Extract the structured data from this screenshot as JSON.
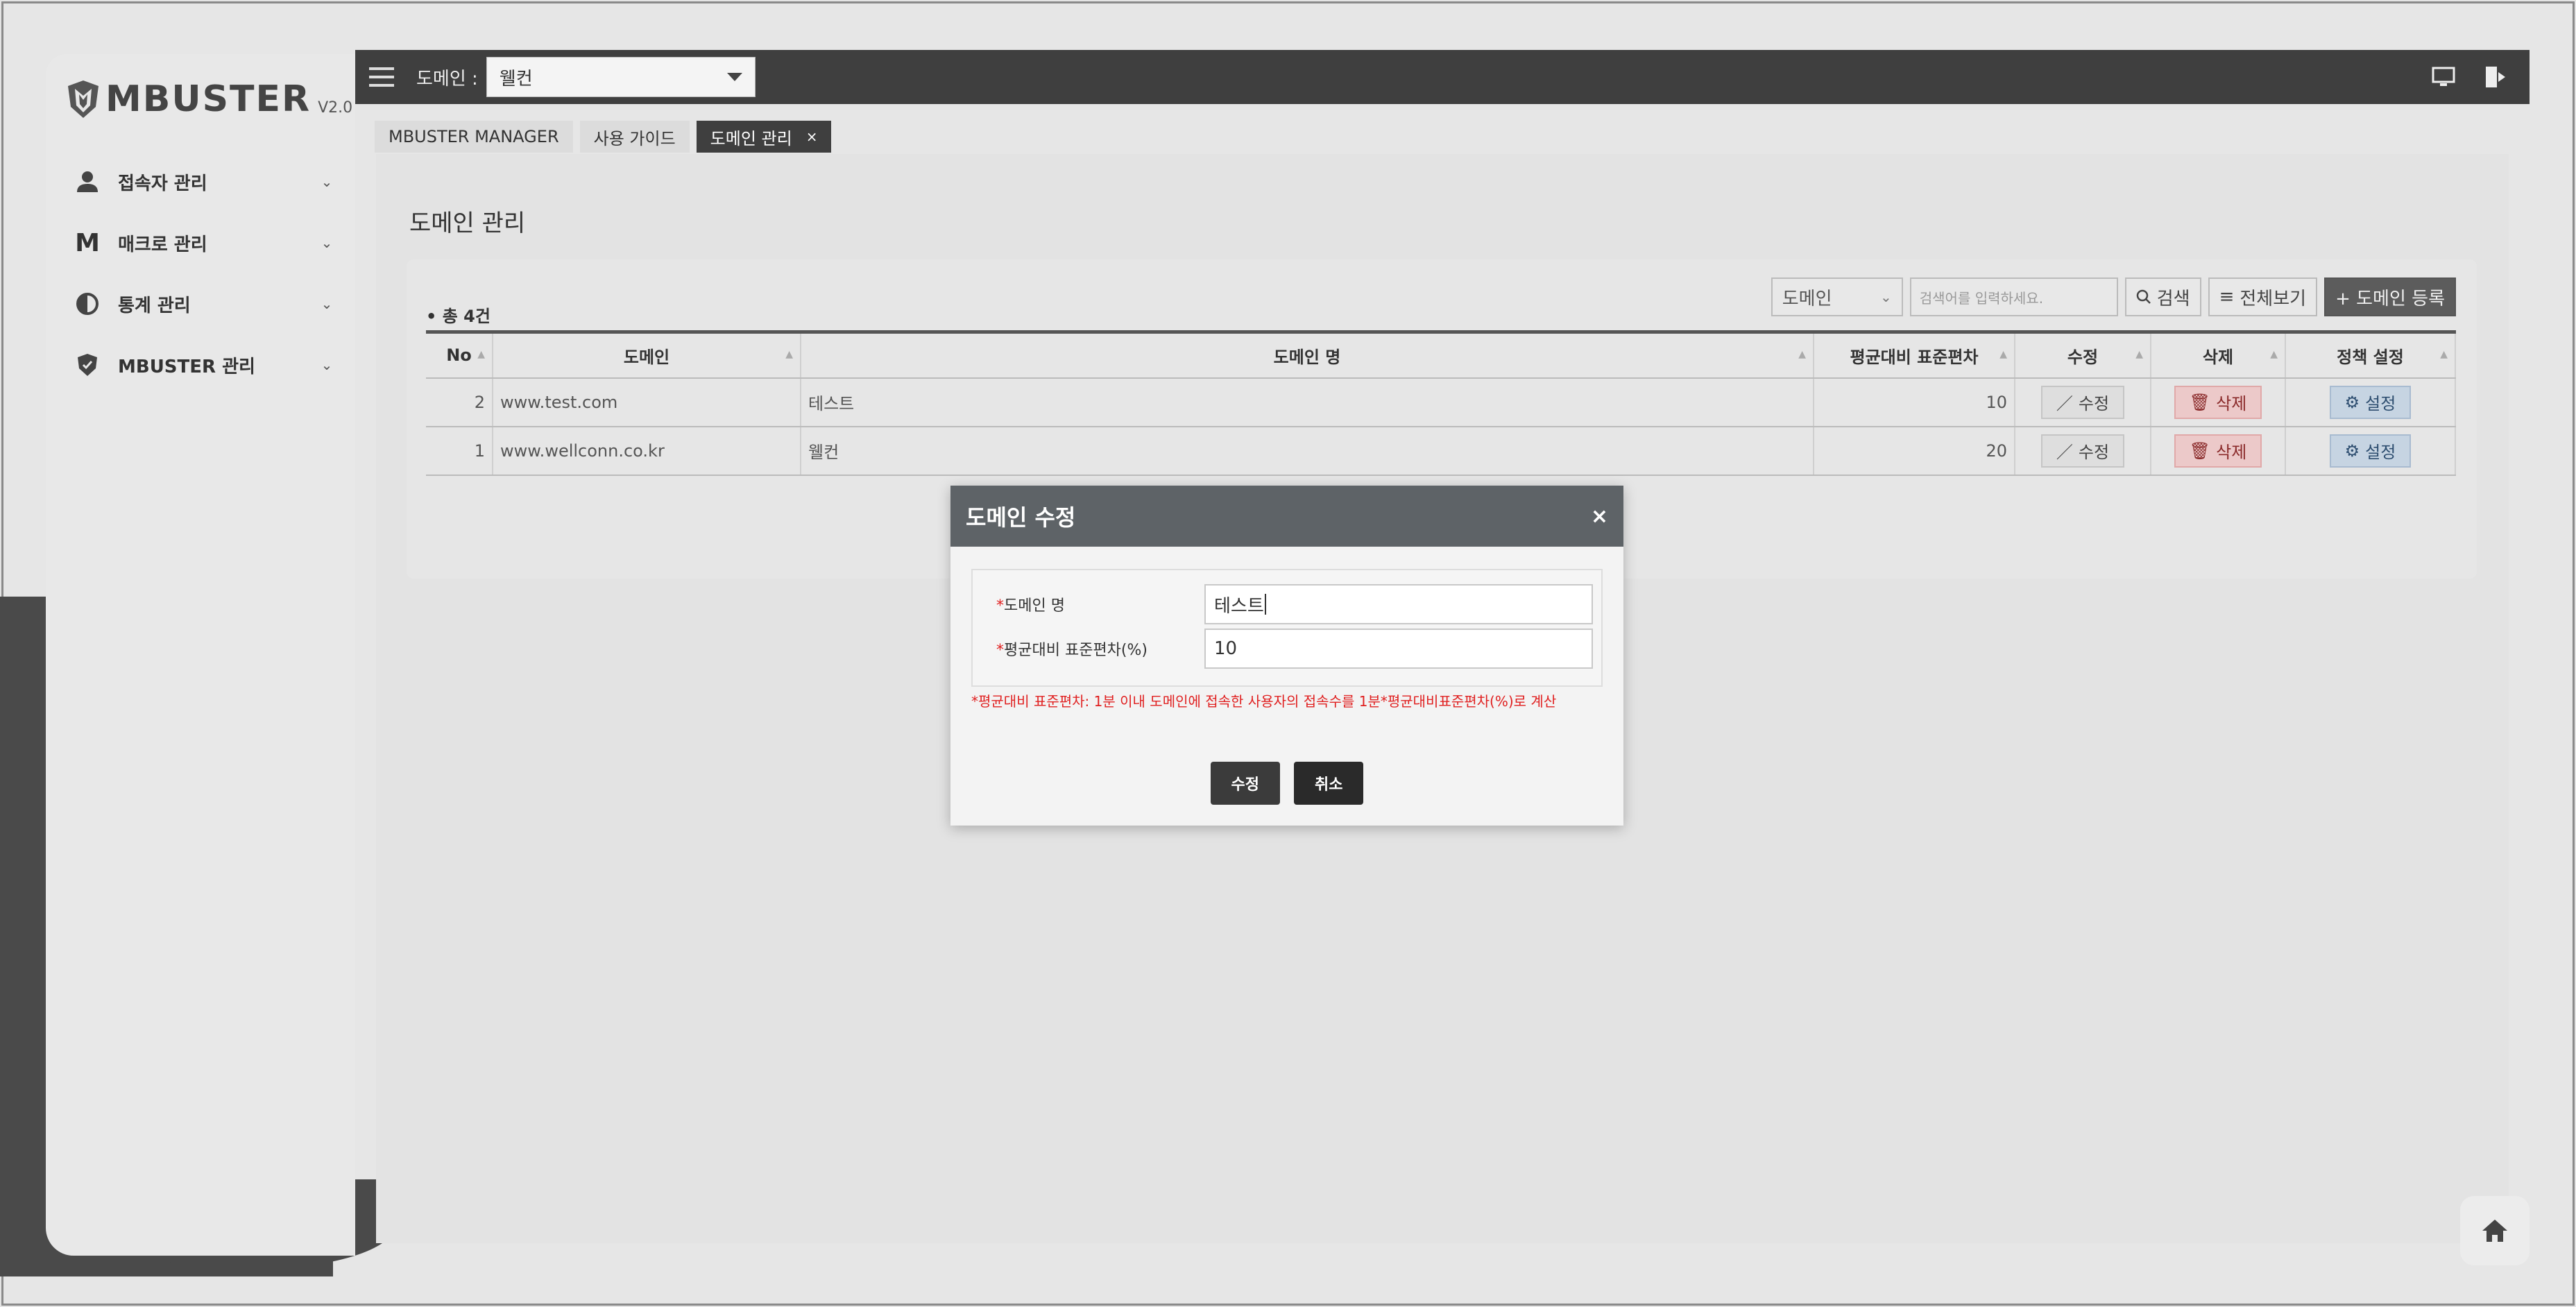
{
  "app": {
    "logo_text": "MBUSTER",
    "version": "V2.0"
  },
  "sidebar": {
    "items": [
      {
        "label": "접속자 관리",
        "icon": "user-icon"
      },
      {
        "label": "매크로 관리",
        "icon": "m-letter-icon"
      },
      {
        "label": "통계 관리",
        "icon": "pie-chart-icon"
      },
      {
        "label": "MBUSTER 관리",
        "icon": "shield-icon"
      }
    ]
  },
  "topbar": {
    "domain_label": "도메인 :",
    "domain_value": "웰컨"
  },
  "tabs": [
    {
      "label": "MBUSTER MANAGER",
      "active": false
    },
    {
      "label": "사용 가이드",
      "active": false
    },
    {
      "label": "도메인 관리",
      "active": true,
      "close": "×"
    }
  ],
  "page": {
    "title": "도메인 관리",
    "count": "• 총 4건"
  },
  "toolbar": {
    "search_type": "도메인",
    "search_placeholder": "검색어를 입력하세요.",
    "search_label": "검색",
    "view_all_label": "전체보기",
    "add_label": "+ 도메인 등록"
  },
  "table": {
    "columns": [
      "No",
      "도메인",
      "도메인 명",
      "평균대비 표준편차",
      "수정",
      "삭제",
      "정책 설정"
    ],
    "rows": [
      {
        "no": "2",
        "domain": "www.test.com",
        "name": "테스트",
        "stddev": "10"
      },
      {
        "no": "1",
        "domain": "www.wellconn.co.kr",
        "name": "웰컨",
        "stddev": "20"
      }
    ],
    "edit_label": "수정",
    "delete_label": "삭제",
    "setting_label": "설정"
  },
  "modal": {
    "title": "도메인 수정",
    "close": "×",
    "fields": [
      {
        "label": "도메인 명",
        "value": "테스트"
      },
      {
        "label": "평균대비 표준편차(%)",
        "value": "10"
      }
    ],
    "note": "*평균대비 표준편차: 1분 이내 도메인에 접속한 사용자의 접속수를 1분*평균대비표준편차(%)로 계산",
    "submit_label": "수정",
    "cancel_label": "취소"
  },
  "colors": {
    "topbar": "#3f3f3f",
    "modal_header": "#5e6367",
    "note_red": "#e02020",
    "delete_bg": "#ecc9c9",
    "setting_bg": "#c6d4e2"
  }
}
